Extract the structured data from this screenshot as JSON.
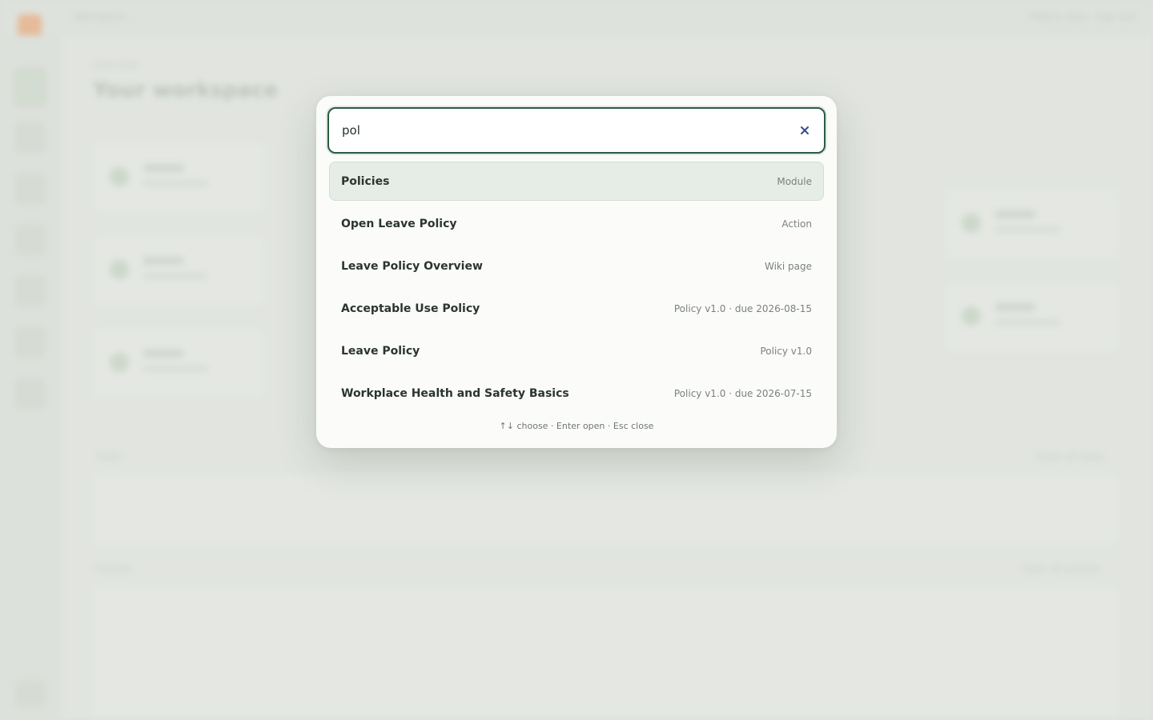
{
  "background": {
    "top_left_link": "Workspace",
    "top_right_links": [
      "Help & docs",
      "Sign out"
    ],
    "breadcrumb": "Overview",
    "page_title": "Your workspace",
    "cards": [
      {
        "title": "Tasks",
        "subtitle": "Open items"
      },
      {
        "title": "Documents",
        "subtitle": "Recent files"
      },
      {
        "title": "Policies",
        "subtitle": "Active policies"
      },
      {
        "title": "Wiki",
        "subtitle": "Team knowledge"
      },
      {
        "title": "Trainings",
        "subtitle": "Due soon"
      }
    ],
    "section_tasks": "Tasks",
    "section_tasks_link": "Open all tasks",
    "section_policies": "Policies",
    "section_policies_link": "Open all policies"
  },
  "palette": {
    "search": {
      "value": "pol",
      "placeholder": "Search"
    },
    "results": [
      {
        "label": "Policies",
        "meta": "Module",
        "selected": true
      },
      {
        "label": "Open Leave Policy",
        "meta": "Action"
      },
      {
        "label": "Leave Policy Overview",
        "meta": "Wiki page"
      },
      {
        "label": "Acceptable Use Policy",
        "meta": "Policy v1.0 · due 2026-08-15"
      },
      {
        "label": "Leave Policy",
        "meta": "Policy v1.0"
      },
      {
        "label": "Workplace Health and Safety Basics",
        "meta": "Policy v1.0 · due 2026-07-15"
      }
    ],
    "hint": "↑↓ choose · Enter open · Esc close"
  },
  "colors": {
    "accent": "#2e5a44",
    "selected_row": "#e6ede6",
    "clear_icon": "#2f4f8a",
    "brand": "#f2a06a"
  },
  "icons": {
    "clear": "close-icon"
  }
}
